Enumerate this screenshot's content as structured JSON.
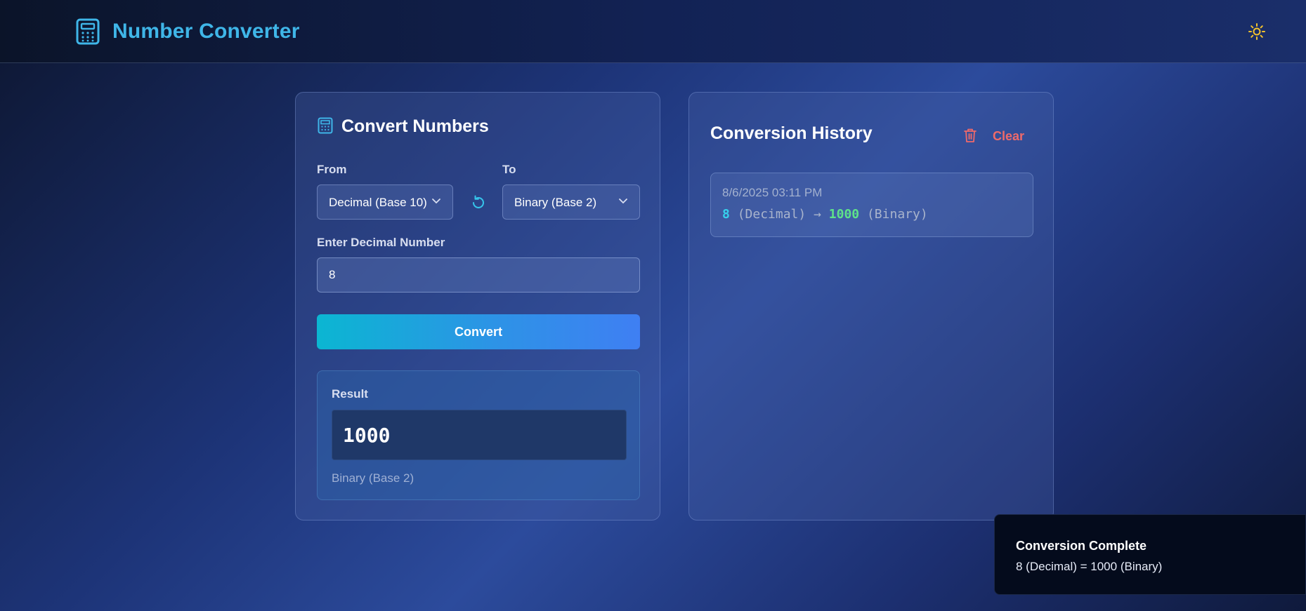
{
  "header": {
    "title": "Number Converter",
    "brand_icon": "calculator-icon",
    "theme_toggle_icon": "sun-icon"
  },
  "converter": {
    "title": "Convert Numbers",
    "from_label": "From",
    "to_label": "To",
    "from_value": "Decimal (Base 10)",
    "to_value": "Binary (Base 2)",
    "swap_icon": "rotate-ccw-icon",
    "input_label": "Enter Decimal Number",
    "input_value": "8",
    "convert_label": "Convert",
    "result_label": "Result",
    "result_value": "1000",
    "result_base": "Binary (Base 2)"
  },
  "history": {
    "title": "Conversion History",
    "clear_label": "Clear",
    "items": [
      {
        "time": "8/6/2025 03:11 PM",
        "input": "8",
        "from": "(Decimal)",
        "arrow": "→",
        "output": "1000",
        "to": "(Binary)"
      }
    ]
  },
  "toast": {
    "title": "Conversion Complete",
    "message": "8 (Decimal) = 1000 (Binary)"
  },
  "colors": {
    "accent": "#3fb6e8",
    "danger": "#ef6a6a",
    "success": "#5ee28a",
    "sun": "#f4c22b"
  }
}
